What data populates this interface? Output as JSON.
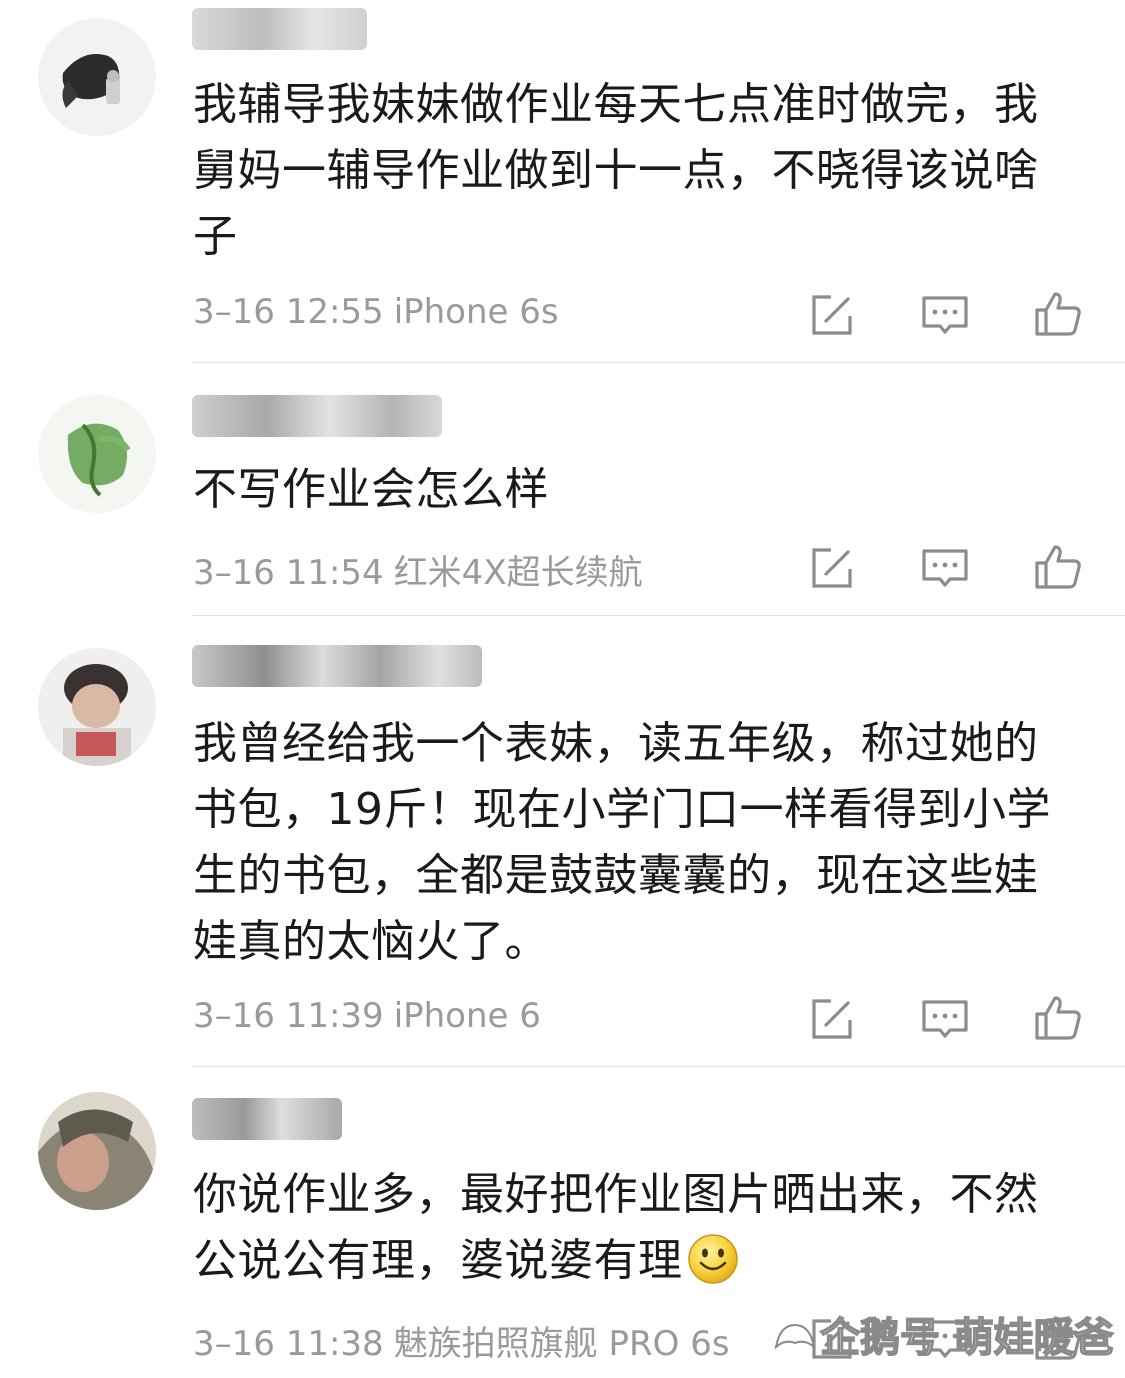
{
  "comments": [
    {
      "username": "",
      "text": "我辅导我妹妹做作业每天七点准时做完，我舅妈一辅导作业做到十一点，不晓得该说啥子",
      "date": "3–16 12:55",
      "device": "iPhone 6s"
    },
    {
      "username": "",
      "text": "不写作业会怎么样",
      "date": "3–16 11:54",
      "device": "红米4X超长续航"
    },
    {
      "username": "",
      "text": "我曾经给我一个表妹，读五年级，称过她的书包，19斤！现在小学门口一样看得到小学生的书包，全都是鼓鼓囊囊的，现在这些娃娃真的太恼火了。",
      "date": "3–16 11:39",
      "device": "iPhone 6"
    },
    {
      "username": "",
      "text": "你说作业多，最好把作业图片晒出来，不然公说公有理，婆说婆有理",
      "date": "3–16 11:38",
      "device": "魅族拍照旗舰 PRO 6s"
    }
  ],
  "icons": {
    "repost": "edit-square-icon",
    "reply": "comment-bubble-icon",
    "like": "thumbs-up-icon",
    "emoji": "smiley-emoji-icon"
  },
  "watermark": {
    "text": "企鹅号 萌娃暖爸"
  },
  "colors": {
    "text": "#1a1a1a",
    "meta": "#9a9a9a",
    "icon": "#8c8c8c",
    "divider": "#e3e3e3"
  }
}
